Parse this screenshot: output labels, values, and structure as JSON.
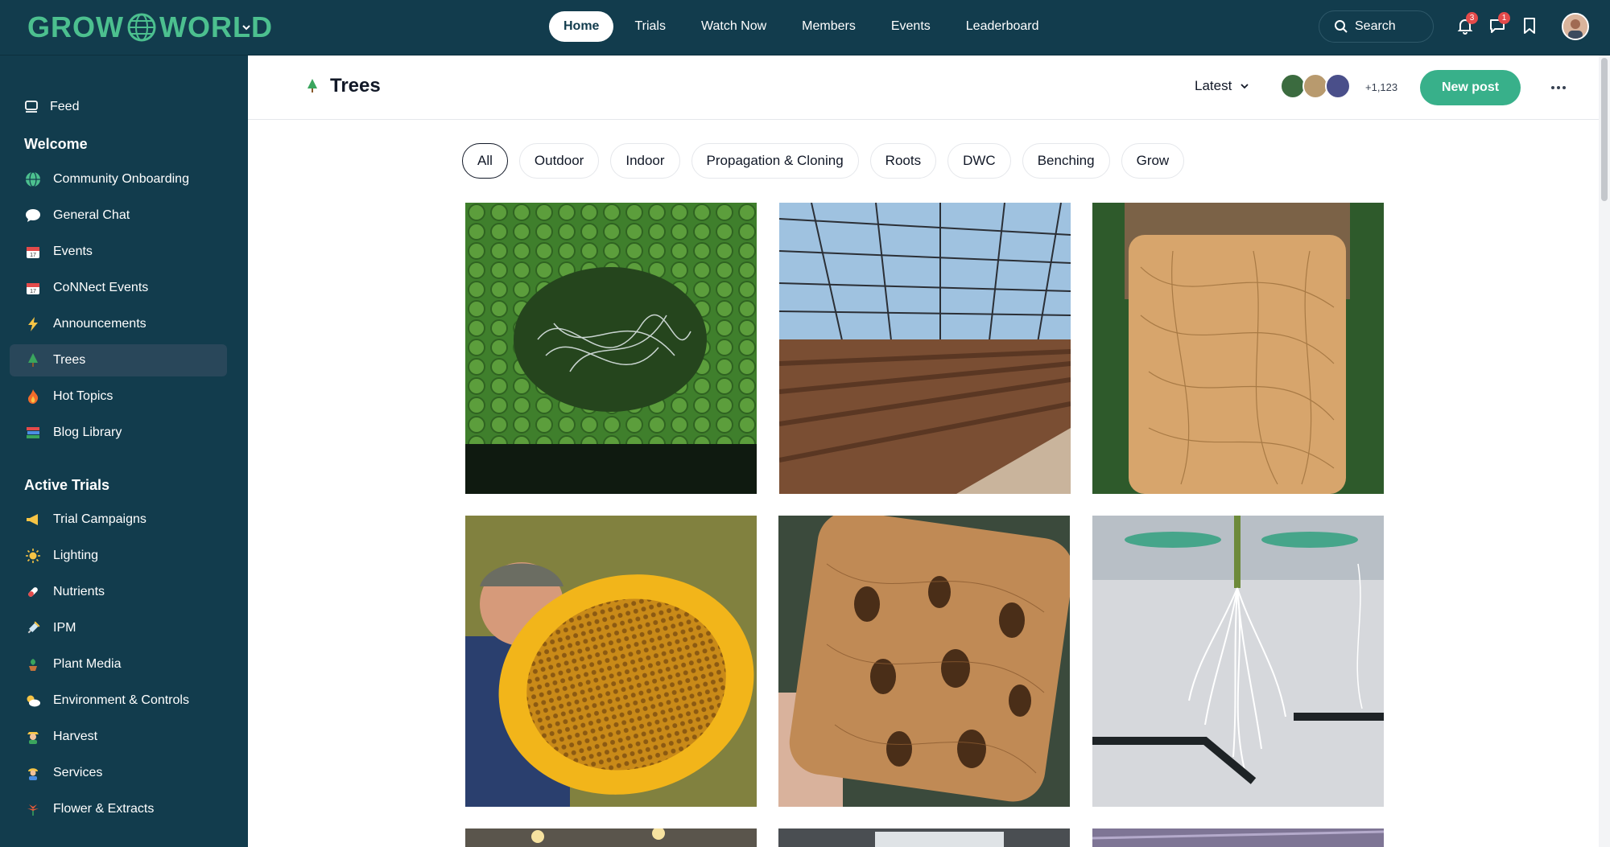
{
  "brand": {
    "name": "GROW WORLD"
  },
  "nav": {
    "items": [
      {
        "label": "Home",
        "active": true
      },
      {
        "label": "Trials",
        "active": false
      },
      {
        "label": "Watch Now",
        "active": false
      },
      {
        "label": "Members",
        "active": false
      },
      {
        "label": "Events",
        "active": false
      },
      {
        "label": "Leaderboard",
        "active": false
      }
    ]
  },
  "topbar": {
    "search_label": "Search",
    "notifications_count": "3",
    "messages_count": "1"
  },
  "sidebar": {
    "feed_label": "Feed",
    "welcome_heading": "Welcome",
    "welcome_items": [
      {
        "label": "Community Onboarding",
        "icon": "globe-icon"
      },
      {
        "label": "General Chat",
        "icon": "speech-bubble-icon"
      },
      {
        "label": "Events",
        "icon": "calendar-icon"
      },
      {
        "label": "CoNNect Events",
        "icon": "calendar-icon"
      },
      {
        "label": "Announcements",
        "icon": "lightning-icon"
      },
      {
        "label": "Trees",
        "icon": "tree-icon",
        "active": true
      },
      {
        "label": "Hot Topics",
        "icon": "fire-icon"
      },
      {
        "label": "Blog Library",
        "icon": "books-icon"
      }
    ],
    "trials_heading": "Active Trials",
    "trial_items": [
      {
        "label": "Trial Campaigns",
        "icon": "megaphone-icon"
      },
      {
        "label": "Lighting",
        "icon": "sun-icon"
      },
      {
        "label": "Nutrients",
        "icon": "pill-icon"
      },
      {
        "label": "IPM",
        "icon": "syringe-icon"
      },
      {
        "label": "Plant Media",
        "icon": "potted-plant-icon"
      },
      {
        "label": "Environment & Controls",
        "icon": "sun-cloud-icon"
      },
      {
        "label": "Harvest",
        "icon": "farmer-icon"
      },
      {
        "label": "Services",
        "icon": "worker-icon"
      },
      {
        "label": "Flower & Extracts",
        "icon": "leaf-icon"
      }
    ]
  },
  "header": {
    "title": "Trees",
    "sort_label": "Latest",
    "member_count": "+1,123",
    "new_post_label": "New post"
  },
  "filters": [
    "All",
    "Outdoor",
    "Indoor",
    "Propagation & Cloning",
    "Roots",
    "DWC",
    "Benching",
    "Grow"
  ],
  "colors": {
    "topbar_bg": "#123c4d",
    "accent": "#38b08a",
    "brand": "#4cc08f"
  }
}
